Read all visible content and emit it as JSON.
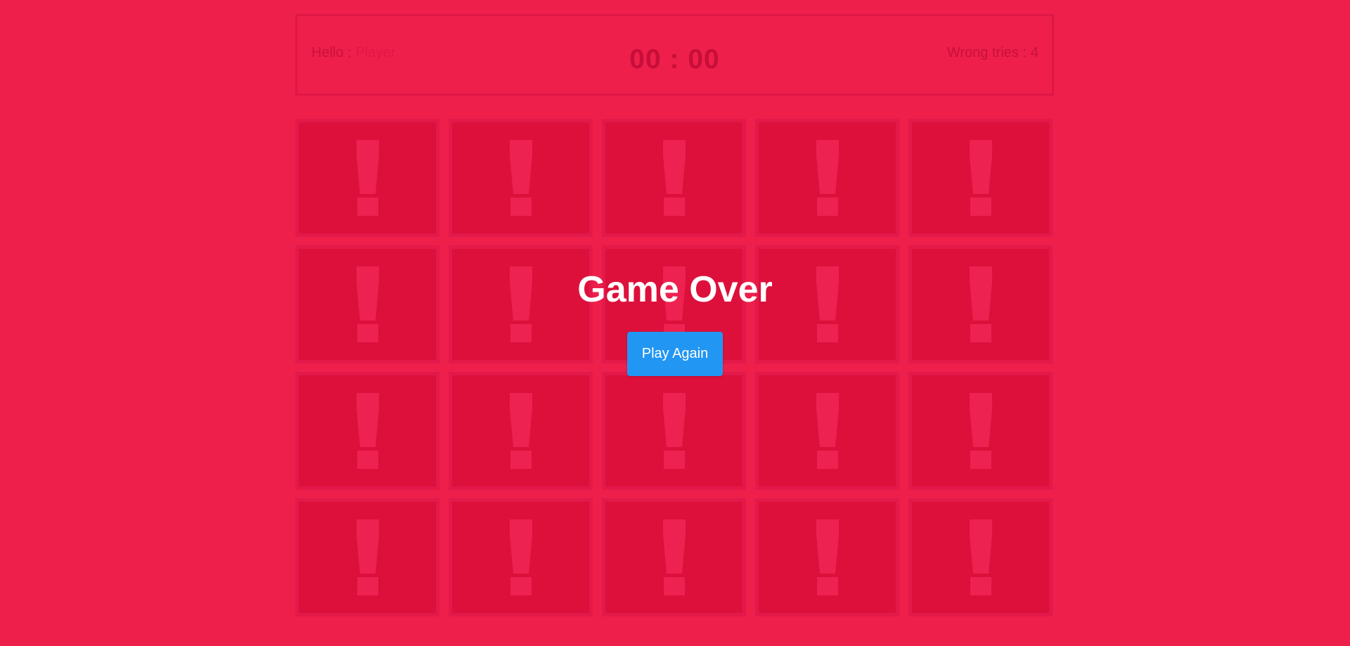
{
  "header": {
    "greeting_label": "Hello :",
    "player_name": "Player",
    "timer": "00 : 00",
    "wrong_tries_label": "Wrong tries :",
    "wrong_tries_value": "4"
  },
  "board": {
    "columns": 5,
    "rows": 4,
    "cards": [
      {
        "face": "hidden",
        "icon": "exclamation-icon"
      },
      {
        "face": "hidden",
        "icon": "exclamation-icon"
      },
      {
        "face": "hidden",
        "icon": "exclamation-icon"
      },
      {
        "face": "hidden",
        "icon": "exclamation-icon"
      },
      {
        "face": "hidden",
        "icon": "exclamation-icon"
      },
      {
        "face": "hidden",
        "icon": "exclamation-icon"
      },
      {
        "face": "hidden",
        "icon": "exclamation-icon"
      },
      {
        "face": "hidden",
        "icon": "exclamation-icon"
      },
      {
        "face": "hidden",
        "icon": "exclamation-icon"
      },
      {
        "face": "hidden",
        "icon": "exclamation-icon"
      },
      {
        "face": "hidden",
        "icon": "exclamation-icon"
      },
      {
        "face": "hidden",
        "icon": "exclamation-icon"
      },
      {
        "face": "hidden",
        "icon": "exclamation-icon"
      },
      {
        "face": "hidden",
        "icon": "exclamation-icon"
      },
      {
        "face": "hidden",
        "icon": "exclamation-icon"
      },
      {
        "face": "hidden",
        "icon": "exclamation-icon"
      },
      {
        "face": "hidden",
        "icon": "exclamation-icon"
      },
      {
        "face": "hidden",
        "icon": "exclamation-icon"
      },
      {
        "face": "hidden",
        "icon": "exclamation-icon"
      },
      {
        "face": "hidden",
        "icon": "exclamation-icon"
      }
    ]
  },
  "overlay": {
    "title": "Game Over",
    "button_label": "Play Again"
  },
  "colors": {
    "background": "#ee1f4b",
    "card_back": "#dd103c",
    "card_border": "#e3194a",
    "icon": "#ee2250",
    "button": "#2196f3",
    "overlay_text": "#ffffff"
  }
}
